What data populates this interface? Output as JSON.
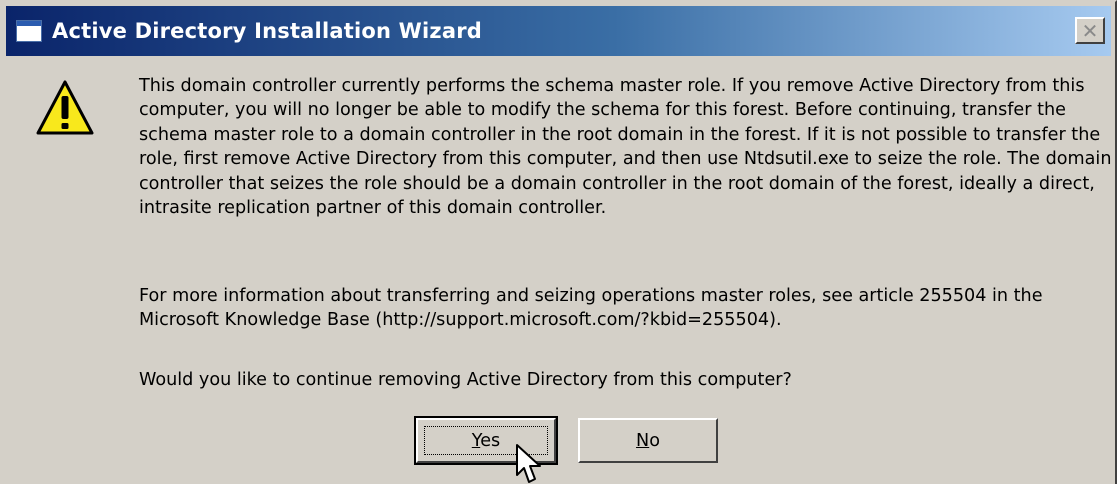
{
  "window": {
    "title": "Active Directory Installation Wizard",
    "close_glyph": "✕"
  },
  "dialog": {
    "icon": "warning-icon",
    "paragraph1": "This domain controller currently performs the schema master role. If you remove Active Directory from this computer, you will no longer be able to modify the schema for this forest. Before continuing, transfer the schema master role to a domain controller in the root domain in the forest. If it is not possible to transfer the role, first remove Active Directory from this computer, and then use Ntdsutil.exe to seize the role. The domain controller that seizes the role should be a domain controller in the root domain of the forest, ideally a direct, intrasite replication partner of this domain controller.",
    "paragraph2": "For more information about transferring and seizing operations master roles, see article 255504 in the Microsoft Knowledge Base (http://support.microsoft.com/?kbid=255504).",
    "paragraph3": "Would you like to continue removing Active Directory from this computer?"
  },
  "buttons": {
    "yes": {
      "mnemonic": "Y",
      "rest": "es"
    },
    "no": {
      "mnemonic": "N",
      "rest": "o"
    }
  },
  "colors": {
    "titlebar_start": "#0a246a",
    "titlebar_end": "#a6caf0",
    "face": "#d4d0c8",
    "warning_fill": "#f8e81c"
  }
}
